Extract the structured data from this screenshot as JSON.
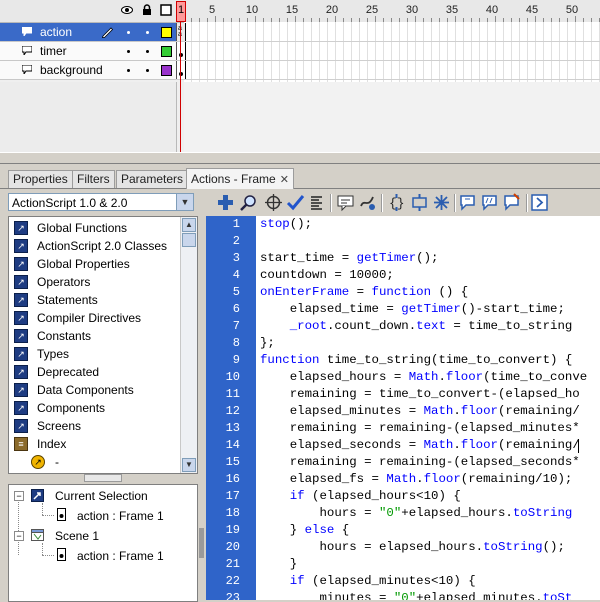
{
  "timeline": {
    "frame_numbers": [
      "1",
      "5",
      "10",
      "15",
      "20",
      "25",
      "30",
      "35",
      "40",
      "45",
      "50"
    ],
    "current_frame": "1",
    "layers": [
      {
        "name": "action",
        "selected": true,
        "color": "#ffff00"
      },
      {
        "name": "timer",
        "selected": false,
        "color": "#33cc33"
      },
      {
        "name": "background",
        "selected": false,
        "color": "#9933cc"
      }
    ],
    "header_icons": [
      "eye-icon",
      "lock-icon",
      "outline-icon"
    ]
  },
  "panel": {
    "tabs": [
      {
        "label": "Properties",
        "active": false
      },
      {
        "label": "Filters",
        "active": false
      },
      {
        "label": "Parameters",
        "active": false
      },
      {
        "label": "Actions - Frame",
        "active": true
      }
    ],
    "tab_close": "✕",
    "version_select": "ActionScript 1.0 & 2.0",
    "library_items": [
      {
        "label": "Global Functions",
        "icon": "book-icon"
      },
      {
        "label": "ActionScript 2.0 Classes",
        "icon": "book-icon"
      },
      {
        "label": "Global Properties",
        "icon": "book-icon"
      },
      {
        "label": "Operators",
        "icon": "book-icon"
      },
      {
        "label": "Statements",
        "icon": "book-icon"
      },
      {
        "label": "Compiler Directives",
        "icon": "book-icon"
      },
      {
        "label": "Constants",
        "icon": "book-icon"
      },
      {
        "label": "Types",
        "icon": "book-icon"
      },
      {
        "label": "Deprecated",
        "icon": "book-icon"
      },
      {
        "label": "Data Components",
        "icon": "book-icon"
      },
      {
        "label": "Components",
        "icon": "book-icon"
      },
      {
        "label": "Screens",
        "icon": "book-icon"
      },
      {
        "label": "Index",
        "icon": "index-icon"
      },
      {
        "label": "-",
        "icon": "operator-icon"
      }
    ],
    "tree": {
      "current_selection": "Current Selection",
      "current_frame": "action : Frame 1",
      "scene": "Scene 1",
      "scene_frame": "action : Frame 1"
    }
  },
  "editor": {
    "lines": [
      {
        "n": "1",
        "t": [
          [
            "k",
            "stop"
          ],
          [
            "p",
            "();"
          ]
        ]
      },
      {
        "n": "2",
        "t": []
      },
      {
        "n": "3",
        "t": [
          [
            "p",
            "start_time = "
          ],
          [
            "k",
            "getTimer"
          ],
          [
            "p",
            "();"
          ]
        ]
      },
      {
        "n": "4",
        "t": [
          [
            "p",
            "countdown = 10000;"
          ]
        ]
      },
      {
        "n": "5",
        "t": [
          [
            "k",
            "onEnterFrame"
          ],
          [
            "p",
            " = "
          ],
          [
            "k",
            "function"
          ],
          [
            "p",
            " () {"
          ]
        ]
      },
      {
        "n": "6",
        "t": [
          [
            "p",
            "    elapsed_time = "
          ],
          [
            "k",
            "getTimer"
          ],
          [
            "p",
            "()-start_time;"
          ]
        ]
      },
      {
        "n": "7",
        "t": [
          [
            "p",
            "    "
          ],
          [
            "k",
            "_root"
          ],
          [
            "p",
            ".count_down."
          ],
          [
            "k",
            "text"
          ],
          [
            "p",
            " = time_to_string"
          ]
        ]
      },
      {
        "n": "8",
        "t": [
          [
            "p",
            "};"
          ]
        ]
      },
      {
        "n": "9",
        "t": [
          [
            "k",
            "function"
          ],
          [
            "p",
            " time_to_string(time_to_convert) {"
          ]
        ]
      },
      {
        "n": "10",
        "t": [
          [
            "p",
            "    elapsed_hours = "
          ],
          [
            "k",
            "Math"
          ],
          [
            "p",
            "."
          ],
          [
            "k",
            "floor"
          ],
          [
            "p",
            "(time_to_conve"
          ]
        ]
      },
      {
        "n": "11",
        "t": [
          [
            "p",
            "    remaining = time_to_convert-(elapsed_ho"
          ]
        ]
      },
      {
        "n": "12",
        "t": [
          [
            "p",
            "    elapsed_minutes = "
          ],
          [
            "k",
            "Math"
          ],
          [
            "p",
            "."
          ],
          [
            "k",
            "floor"
          ],
          [
            "p",
            "(remaining/"
          ]
        ]
      },
      {
        "n": "13",
        "t": [
          [
            "p",
            "    remaining = remaining-(elapsed_minutes*"
          ]
        ]
      },
      {
        "n": "14",
        "t": [
          [
            "p",
            "    elapsed_seconds = "
          ],
          [
            "k",
            "Math"
          ],
          [
            "p",
            "."
          ],
          [
            "k",
            "floor"
          ],
          [
            "p",
            "(remaining/"
          ]
        ]
      },
      {
        "n": "15",
        "t": [
          [
            "p",
            "    remaining = remaining-(elapsed_seconds*"
          ]
        ]
      },
      {
        "n": "16",
        "t": [
          [
            "p",
            "    elapsed_fs = "
          ],
          [
            "k",
            "Math"
          ],
          [
            "p",
            "."
          ],
          [
            "k",
            "floor"
          ],
          [
            "p",
            "(remaining/10);"
          ]
        ]
      },
      {
        "n": "17",
        "t": [
          [
            "p",
            "    "
          ],
          [
            "k",
            "if"
          ],
          [
            "p",
            " (elapsed_hours<10) {"
          ]
        ]
      },
      {
        "n": "18",
        "t": [
          [
            "p",
            "        hours = "
          ],
          [
            "s",
            "\"0\""
          ],
          [
            "p",
            "+elapsed_hours."
          ],
          [
            "k",
            "toString"
          ]
        ]
      },
      {
        "n": "19",
        "t": [
          [
            "p",
            "    } "
          ],
          [
            "k",
            "else"
          ],
          [
            "p",
            " {"
          ]
        ]
      },
      {
        "n": "20",
        "t": [
          [
            "p",
            "        hours = elapsed_hours."
          ],
          [
            "k",
            "toString"
          ],
          [
            "p",
            "();"
          ]
        ]
      },
      {
        "n": "21",
        "t": [
          [
            "p",
            "    }"
          ]
        ]
      },
      {
        "n": "22",
        "t": [
          [
            "p",
            "    "
          ],
          [
            "k",
            "if"
          ],
          [
            "p",
            " (elapsed_minutes<10) {"
          ]
        ]
      },
      {
        "n": "23",
        "t": [
          [
            "p",
            "        minutes = "
          ],
          [
            "s",
            "\"0\""
          ],
          [
            "p",
            "+elapsed_minutes."
          ],
          [
            "k",
            "toSt"
          ]
        ]
      }
    ]
  },
  "colors": {
    "keyword": "#0000ff",
    "string": "#009900",
    "gutter": "#2f64c9",
    "selected_layer": "#3a6ac8",
    "playhead": "#d00000"
  }
}
